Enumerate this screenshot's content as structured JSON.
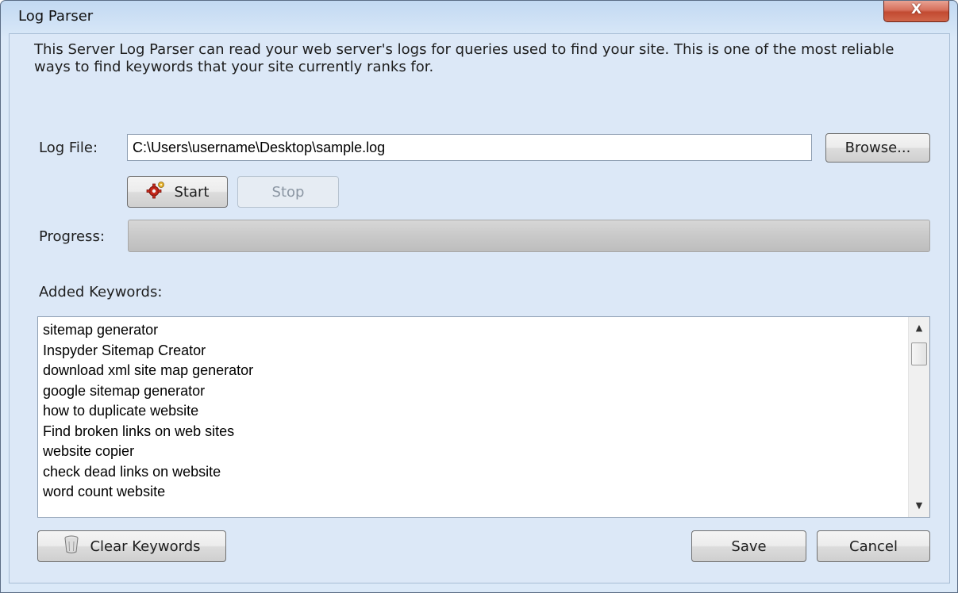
{
  "window": {
    "title": "Log Parser",
    "close_label": "X"
  },
  "description": "This Server Log Parser can read your web server's logs for queries used to find your site. This is one of the most reliable ways to find keywords that your site currently ranks for.",
  "log_file": {
    "label": "Log File:",
    "value": "C:\\Users\\username\\Desktop\\sample.log",
    "browse_label": "Browse..."
  },
  "controls": {
    "start_label": "Start",
    "start_icon": "gear-icon",
    "stop_label": "Stop"
  },
  "progress": {
    "label": "Progress:",
    "value_percent": 0
  },
  "keywords": {
    "label": "Added Keywords:",
    "items": [
      "sitemap generator",
      "Inspyder Sitemap Creator",
      "download xml site map generator",
      "google sitemap generator",
      "how to duplicate website",
      "Find broken links on web sites",
      "website copier",
      "check dead links on website",
      "word count website"
    ]
  },
  "footer": {
    "clear_label": "Clear Keywords",
    "clear_icon": "trash-icon",
    "save_label": "Save",
    "cancel_label": "Cancel"
  },
  "colors": {
    "close_button": "#c9543c",
    "window_background": "#dce8f7"
  }
}
